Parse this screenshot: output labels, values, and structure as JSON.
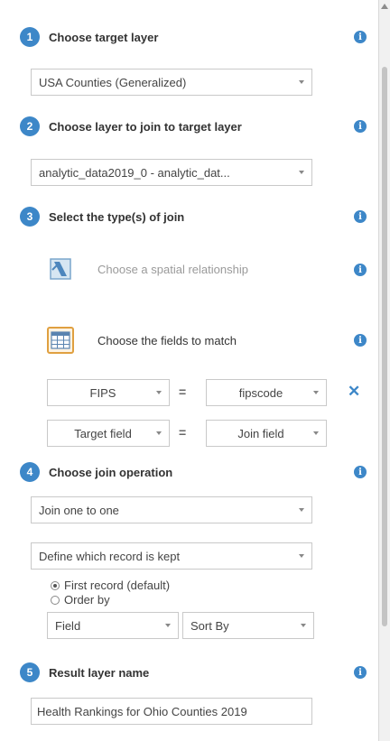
{
  "steps": [
    {
      "number": "1",
      "title": "Choose target layer"
    },
    {
      "number": "2",
      "title": "Choose layer to join to target layer"
    },
    {
      "number": "3",
      "title": "Select the type(s) of join"
    },
    {
      "number": "4",
      "title": "Choose join operation"
    },
    {
      "number": "5",
      "title": "Result layer name"
    }
  ],
  "info_glyph": "i",
  "target_layer": {
    "selected": "USA Counties (Generalized)"
  },
  "join_layer": {
    "selected": "analytic_data2019_0 - analytic_dat..."
  },
  "join_types": {
    "spatial": {
      "label": "Choose a spatial relationship",
      "icon": "map-spatial-icon"
    },
    "fields": {
      "label": "Choose the fields to match",
      "icon": "table-grid-icon"
    }
  },
  "field_match": {
    "equals": "=",
    "remove_glyph": "✕",
    "rows": [
      {
        "target": "FIPS",
        "join": "fipscode"
      },
      {
        "target": "Target field",
        "join": "Join field"
      }
    ]
  },
  "join_operation": {
    "selected": "Join one to one",
    "record_kept": {
      "selected": "Define which record is kept",
      "options": [
        {
          "label": "First record (default)",
          "checked": true
        },
        {
          "label": "Order by",
          "checked": false
        }
      ],
      "order_field": "Field",
      "sort_by": "Sort By"
    }
  },
  "result_layer": {
    "value": "Health Rankings for Ohio Counties 2019"
  },
  "colors": {
    "accent": "#3d87c8",
    "border": "#c9c9c9"
  }
}
